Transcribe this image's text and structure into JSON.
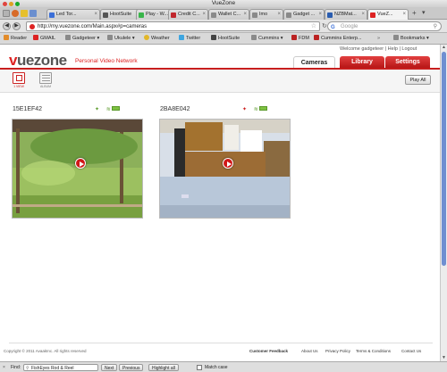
{
  "window": {
    "title": "VueZone"
  },
  "tabs": [
    {
      "label": "Led Tor..."
    },
    {
      "label": "HootSuite"
    },
    {
      "label": "Play - W..."
    },
    {
      "label": "Credit C..."
    },
    {
      "label": "Wallet C..."
    },
    {
      "label": "Imo"
    },
    {
      "label": "Gadget ..."
    },
    {
      "label": "NZBMat..."
    },
    {
      "label": "VueZ..."
    }
  ],
  "nav": {
    "url": "http://my.vuezone.com/Main.aspx#p=cameras",
    "search_placeholder": "Google"
  },
  "bookmarks": [
    {
      "label": "Reader"
    },
    {
      "label": "GMAIL"
    },
    {
      "label": "Gadgeteer ▾"
    },
    {
      "label": "Ukulele ▾"
    },
    {
      "label": "Weather"
    },
    {
      "label": "Twitter"
    },
    {
      "label": "HootSuite"
    },
    {
      "label": "Cummins ▾"
    },
    {
      "label": "FDM"
    },
    {
      "label": "Cummins Enterp..."
    },
    {
      "label": "Bookmarks ▾"
    }
  ],
  "site": {
    "logo": {
      "prefix": "v",
      "rest": "uezone"
    },
    "tagline": "Personal Video Network",
    "welcome": "Welcome gadgeteer  |  Help  |  Logout",
    "tabs": {
      "cameras": "Cameras",
      "library": "Library",
      "settings": "Settings"
    },
    "play_all": "Play All",
    "view_labels": {
      "grid": "1 VIEW",
      "list": "ALBUM"
    }
  },
  "cameras": [
    {
      "name": "15E1EF42",
      "battery": "BAT"
    },
    {
      "name": "2BA8E042",
      "battery": "BAT"
    }
  ],
  "footer": {
    "copyright": "Copyright © 2011 AvaakInc. All rights reserved",
    "links": [
      "Customer Feedback",
      "About Us",
      "Privacy Policy",
      "Terms & Conditions",
      "Contact Us"
    ]
  },
  "findbar": {
    "label": "Find:",
    "query": "FishEyes Rod & Reel",
    "next": "Next",
    "previous": "Previous",
    "highlight": "Highlight all",
    "match_case": "Match case"
  },
  "colors": {
    "brand_red": "#c81e1e",
    "accent_green": "#7ec142"
  }
}
